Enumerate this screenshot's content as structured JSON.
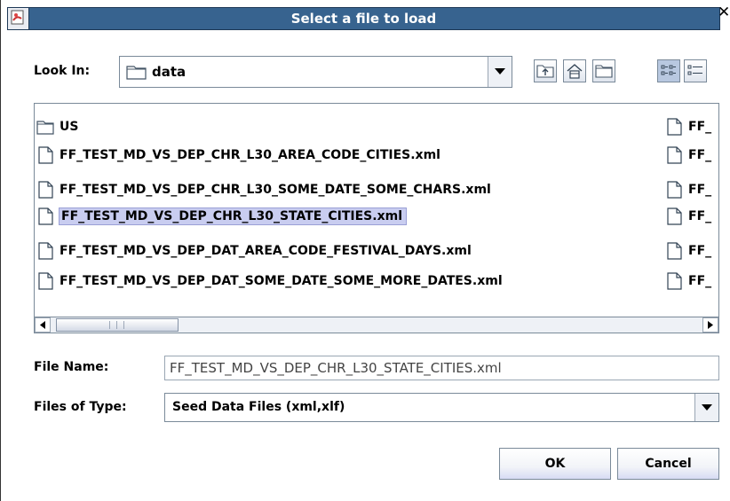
{
  "window": {
    "title": "Select a file to load",
    "close_glyph": "✕"
  },
  "lookin": {
    "label": "Look In:",
    "value": "data",
    "icons": [
      "up-folder-icon",
      "home-icon",
      "new-folder-icon",
      "list-view-icon",
      "details-view-icon"
    ]
  },
  "files": {
    "col1": [
      {
        "name": "US",
        "type": "folder",
        "selected": false
      },
      {
        "name": "FF_TEST_MD_VS_DEP_CHR_L30_AREA_CODE_CITIES.xml",
        "type": "file",
        "selected": false
      },
      {
        "name": "FF_TEST_MD_VS_DEP_CHR_L30_SOME_DATE_SOME_CHARS.xml",
        "type": "file",
        "selected": false
      },
      {
        "name": "FF_TEST_MD_VS_DEP_CHR_L30_STATE_CITIES.xml",
        "type": "file",
        "selected": true
      },
      {
        "name": "FF_TEST_MD_VS_DEP_DAT_AREA_CODE_FESTIVAL_DAYS.xml",
        "type": "file",
        "selected": false
      },
      {
        "name": "FF_TEST_MD_VS_DEP_DAT_SOME_DATE_SOME_MORE_DATES.xml",
        "type": "file",
        "selected": false
      }
    ],
    "col2": [
      "FF_",
      "FF_",
      "FF_",
      "FF_",
      "FF_",
      "FF_"
    ]
  },
  "filename": {
    "label": "File Name:",
    "value": "FF_TEST_MD_VS_DEP_CHR_L30_STATE_CITIES.xml"
  },
  "filetype": {
    "label": "Files of Type:",
    "value": "Seed Data Files (xml,xlf)"
  },
  "buttons": {
    "ok": "OK",
    "cancel": "Cancel"
  }
}
